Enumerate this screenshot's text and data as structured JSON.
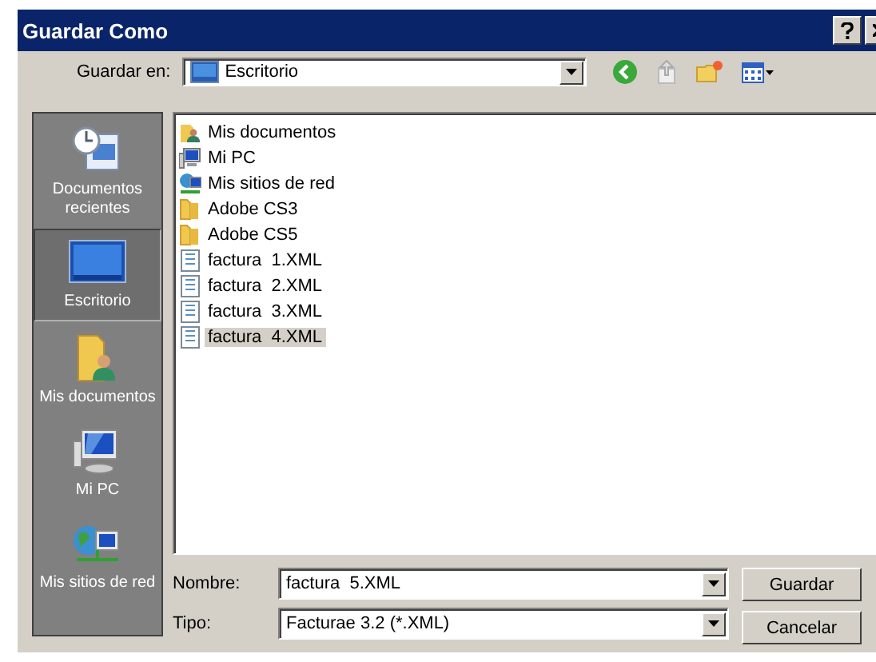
{
  "window": {
    "title": "Guardar Como"
  },
  "toolbar": {
    "label": "Guardar en:",
    "location": "Escritorio"
  },
  "sidebar": {
    "items": [
      {
        "label": "Documentos recientes",
        "kind": "recent",
        "selected": false
      },
      {
        "label": "Escritorio",
        "kind": "desktop",
        "selected": true
      },
      {
        "label": "Mis documentos",
        "kind": "mydocs",
        "selected": false
      },
      {
        "label": "Mi PC",
        "kind": "pc",
        "selected": false
      },
      {
        "label": "Mis sitios de red",
        "kind": "network",
        "selected": false
      }
    ]
  },
  "files": [
    {
      "name": "Mis documentos",
      "kind": "mydocs",
      "selected": false
    },
    {
      "name": "Mi PC",
      "kind": "pc",
      "selected": false
    },
    {
      "name": "Mis sitios de red",
      "kind": "network",
      "selected": false
    },
    {
      "name": "Adobe CS3",
      "kind": "folder",
      "selected": false
    },
    {
      "name": "Adobe CS5",
      "kind": "folder",
      "selected": false
    },
    {
      "name": "factura  1.XML",
      "kind": "xml",
      "selected": false
    },
    {
      "name": "factura  2.XML",
      "kind": "xml",
      "selected": false
    },
    {
      "name": "factura  3.XML",
      "kind": "xml",
      "selected": false
    },
    {
      "name": "factura  4.XML",
      "kind": "xml",
      "selected": true
    }
  ],
  "fields": [
    {
      "label": "Nombre:",
      "value": "factura  5.XML"
    },
    {
      "label": "Tipo:",
      "value": "Facturae 3.2 (*.XML)"
    }
  ],
  "buttons": [
    "Guardar",
    "Cancelar"
  ]
}
